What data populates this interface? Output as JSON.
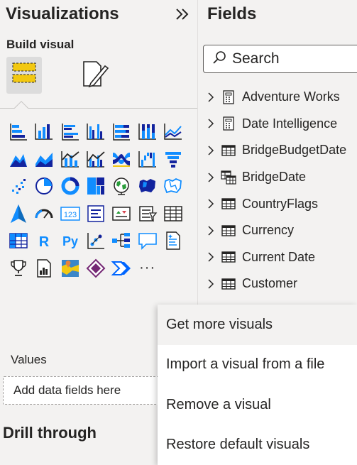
{
  "visualizations": {
    "title": "Visualizations",
    "collapse_icon": "double-chevron-right-icon",
    "build_label": "Build visual",
    "modes": [
      "build-visual-icon",
      "format-visual-icon"
    ],
    "visual_icons": [
      "stacked-bar-chart-icon",
      "stacked-column-chart-icon",
      "clustered-bar-chart-icon",
      "clustered-column-chart-icon",
      "100-stacked-bar-chart-icon",
      "100-stacked-column-chart-icon",
      "line-chart-icon",
      "area-chart-icon",
      "stacked-area-chart-icon",
      "line-and-stacked-column-chart-icon",
      "line-and-clustered-column-chart-icon",
      "ribbon-chart-icon",
      "waterfall-chart-icon",
      "funnel-icon",
      "scatter-chart-icon",
      "pie-chart-icon",
      "donut-chart-icon",
      "treemap-icon",
      "map-icon",
      "filled-map-icon",
      "shape-map-icon",
      "azure-map-icon",
      "gauge-icon",
      "card-icon",
      "multi-row-card-icon",
      "kpi-icon",
      "slicer-icon",
      "table-icon",
      "matrix-icon",
      "r-script-visual-icon",
      "python-visual-icon",
      "key-influencers-icon",
      "decomposition-tree-icon",
      "qa-icon",
      "smart-narrative-icon",
      "metrics-icon",
      "paginated-report-icon",
      "arcgis-map-icon",
      "power-apps-icon",
      "power-automate-icon",
      "more-options-icon"
    ],
    "card_text": "123",
    "r_text": "R",
    "py_text": "Py",
    "more_text": "···",
    "values_label": "Values",
    "drop_zone_placeholder": "Add data fields here",
    "drill_through_title": "Drill through"
  },
  "fields": {
    "title": "Fields",
    "search_placeholder": "Search",
    "items": [
      {
        "label": "Adventure Works",
        "icon": "calculator-icon"
      },
      {
        "label": "Date Intelligence",
        "icon": "calculator-icon"
      },
      {
        "label": "BridgeBudgetDate",
        "icon": "table-icon"
      },
      {
        "label": "BridgeDate",
        "icon": "multi-table-icon"
      },
      {
        "label": "CountryFlags",
        "icon": "table-icon"
      },
      {
        "label": "Currency",
        "icon": "table-icon"
      },
      {
        "label": "Current Date",
        "icon": "table-icon"
      },
      {
        "label": "Customer",
        "icon": "table-icon"
      }
    ]
  },
  "context_menu": {
    "items": [
      {
        "label": "Get more visuals"
      },
      {
        "label": "Import a visual from a file"
      },
      {
        "label": "Remove a visual"
      },
      {
        "label": "Restore default visuals"
      }
    ]
  },
  "colors": {
    "accent_blue": "#118dff",
    "dark_blue": "#12239e",
    "yellow": "#f2c811",
    "gray_icon": "#605e5c",
    "pane_bg": "#f3f2f1"
  }
}
